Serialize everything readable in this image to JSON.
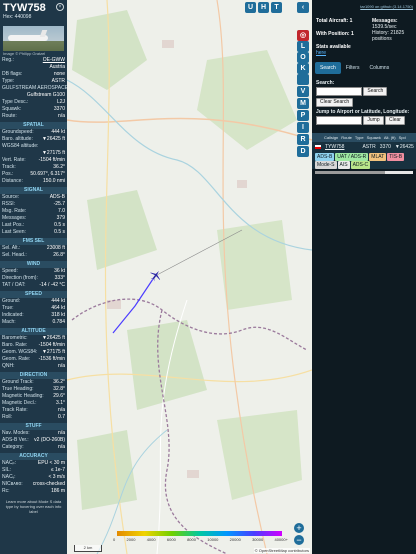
{
  "info": {
    "callsign": "TYW758",
    "hex": "Hex: 440098",
    "close_glyph": "×",
    "photo_credit": "Image © Philipp Gratzel",
    "header_rows": [
      {
        "label": "Reg.:",
        "value": "OE-GWW",
        "link": true
      },
      {
        "label": "",
        "value": "Austria"
      },
      {
        "label": "DB flags:",
        "value": "none"
      },
      {
        "label": "Type:",
        "value": "ASTR"
      },
      {
        "label": "GULFSTREAM AEROSPACE",
        "value": ""
      },
      {
        "label": "",
        "value": "Gulfstream G100"
      },
      {
        "label": "Type Desc.:",
        "value": "L2J"
      },
      {
        "label": "Squawk:",
        "value": "3370"
      },
      {
        "label": "Route:",
        "value": "n/a"
      }
    ],
    "sections": [
      {
        "title": "SPATIAL",
        "rows": [
          {
            "label": "Groundspeed:",
            "value": "444 kt"
          },
          {
            "label": "Baro. altitude:",
            "value": "▼26425 ft"
          },
          {
            "label": "WGS84 altitude:",
            "value": ""
          },
          {
            "label": "",
            "value": "▼27175 ft"
          },
          {
            "label": "Vert. Rate:",
            "value": "-1504 ft/min"
          },
          {
            "label": "Track:",
            "value": "36.2°"
          },
          {
            "label": "Pos.:",
            "value": "50.697°, 6.317°"
          },
          {
            "label": "Distance:",
            "value": "150.0 nmi"
          }
        ]
      },
      {
        "title": "SIGNAL",
        "rows": [
          {
            "label": "Source:",
            "value": "ADS-B"
          },
          {
            "label": "RSSI:",
            "value": "-25.7"
          },
          {
            "label": "Msg. Rate:",
            "value": "7.0"
          },
          {
            "label": "Messages:",
            "value": "379"
          },
          {
            "label": "Last Pos.:",
            "value": "0.5 s"
          },
          {
            "label": "Last Seen:",
            "value": "0.5 s"
          }
        ]
      },
      {
        "title": "FMS SEL",
        "rows": [
          {
            "label": "Sel. Alt.:",
            "value": "23008 ft"
          },
          {
            "label": "Sel. Head.:",
            "value": "26.8°"
          }
        ]
      },
      {
        "title": "WIND",
        "rows": [
          {
            "label": "Speed:",
            "value": "36 kt"
          },
          {
            "label": "Direction (from):",
            "value": "333°"
          },
          {
            "label": "TAT / OAT:",
            "value": "-14 / -42 °C"
          }
        ]
      },
      {
        "title": "SPEED",
        "rows": [
          {
            "label": "Ground:",
            "value": "444 kt"
          },
          {
            "label": "True:",
            "value": "464 kt"
          },
          {
            "label": "Indicated:",
            "value": "318 kt"
          },
          {
            "label": "Mach:",
            "value": "0.784"
          }
        ]
      },
      {
        "title": "ALTITUDE",
        "rows": [
          {
            "label": "Barometric:",
            "value": "▼26425 ft"
          },
          {
            "label": "Baro. Rate:",
            "value": "-1504 ft/min"
          },
          {
            "label": "Geom. WGS84:",
            "value": "▼27175 ft"
          },
          {
            "label": "Geom. Rate:",
            "value": "-1536 ft/min"
          },
          {
            "label": "QNH:",
            "value": "n/a"
          }
        ]
      },
      {
        "title": "DIRECTION",
        "rows": [
          {
            "label": "Ground Track:",
            "value": "36.2°"
          },
          {
            "label": "True Heading:",
            "value": "32.8°"
          },
          {
            "label": "Magnetic Heading:",
            "value": "29.6°"
          },
          {
            "label": "Magnetic Decl.:",
            "value": "3.1°"
          },
          {
            "label": "Track Rate:",
            "value": "n/a"
          },
          {
            "label": "Roll:",
            "value": "0.7"
          }
        ]
      },
      {
        "title": "STUFF",
        "rows": [
          {
            "label": "Nav. Modes:",
            "value": "n/a"
          },
          {
            "label": "ADS-B Ver.:",
            "value": "v2 (DO-260B)"
          },
          {
            "label": "Category:",
            "value": "n/a"
          }
        ]
      },
      {
        "title": "ACCURACY",
        "rows": [
          {
            "label": "NACₚ:",
            "value": "EPU < 30 m"
          },
          {
            "label": "SIL:",
            "value": "≤ 1e-7"
          },
          {
            "label": "NACᵥ:",
            "value": "< 3 m/s"
          },
          {
            "label": "NICʙᴀʀᴏ:",
            "value": "cross-checked"
          },
          {
            "label": "Rc:",
            "value": "186 m"
          }
        ]
      }
    ],
    "footer": "Learn more about Mode S data type by hovering over each info label"
  },
  "map": {
    "right_buttons": [
      "‹",
      "◎",
      "L",
      "O",
      "K",
      "",
      "V",
      "M",
      "P",
      "I",
      "R",
      "D"
    ],
    "top_buttons": [
      "U",
      "H",
      "T"
    ],
    "zoom_in": "+",
    "zoom_out": "−",
    "scale": "2 km",
    "alt_labels": [
      "0",
      "2000",
      "4000",
      "6000",
      "8000",
      "10000",
      "20000",
      "30000",
      "40000+"
    ],
    "attribution": "© OpenStreetMap contributors",
    "aircraft_track_deg": 36.2
  },
  "panel": {
    "version": "tar1090 on github (3.14.1750)",
    "total_label": "Total Aircraft: 1",
    "with_pos_label": "With Position: 1",
    "stats_label": "Stats available",
    "stats_link": "here",
    "messages_label": "Messages:",
    "messages_value": "1539.5/sec",
    "history_label": "History: 21825 positions",
    "tabs": [
      "Search",
      "Filters",
      "Columns"
    ],
    "search_label": "Search:",
    "search_button": "Search",
    "clear_search": "Clear Search",
    "jump_label": "Jump to Airport or Latitude, Longitude:",
    "jump_button": "Jump",
    "clear_button": "Clear",
    "table_headers": [
      "Callsign",
      "Route",
      "Type",
      "Squawk",
      "Alt. (ft)",
      "Spd"
    ],
    "row": {
      "callsign": "TYW758",
      "type": "ASTR",
      "squawk": "3370",
      "alt": "▼26425"
    },
    "badges": [
      {
        "text": "ADS-B",
        "color": "#8fd2ef"
      },
      {
        "text": "UAT / ADS-R",
        "color": "#9ee7a1"
      },
      {
        "text": "MLAT",
        "color": "#f1c27d"
      },
      {
        "text": "TIS-B",
        "color": "#f08fa0"
      },
      {
        "text": "Mode-S",
        "color": "#d7d7d7"
      },
      {
        "text": "AIS",
        "color": "#e9e9e9"
      },
      {
        "text": "ADS-C",
        "color": "#b9e58a"
      }
    ]
  }
}
